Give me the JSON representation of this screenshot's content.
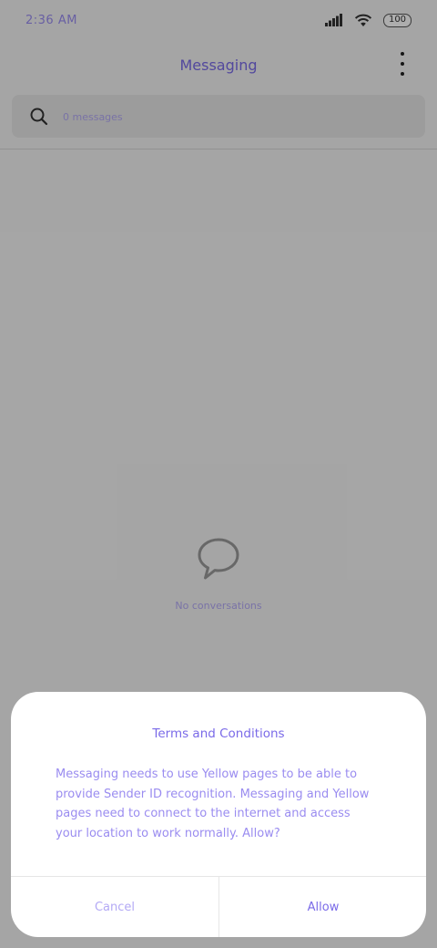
{
  "status_bar": {
    "time": "2:36 AM",
    "battery": "100",
    "icons": [
      "signal-icon",
      "wifi-icon",
      "battery-icon"
    ]
  },
  "header": {
    "title": "Messaging",
    "menu_icon": "more-vertical-icon"
  },
  "search": {
    "icon": "search-icon",
    "placeholder": "0 messages"
  },
  "empty_state": {
    "icon": "chat-bubble-icon",
    "text": "No conversations"
  },
  "dialog": {
    "title": "Terms and Conditions",
    "body": "Messaging needs to use Yellow pages to be able to provide Sender ID recognition. Messaging and Yellow pages need to connect to the internet and access your location to work normally. Allow?",
    "cancel_label": "Cancel",
    "allow_label": "Allow"
  },
  "colors": {
    "accent": "#7a6ae8",
    "accent_light": "#9a8cf0",
    "scrim": "#000000"
  }
}
